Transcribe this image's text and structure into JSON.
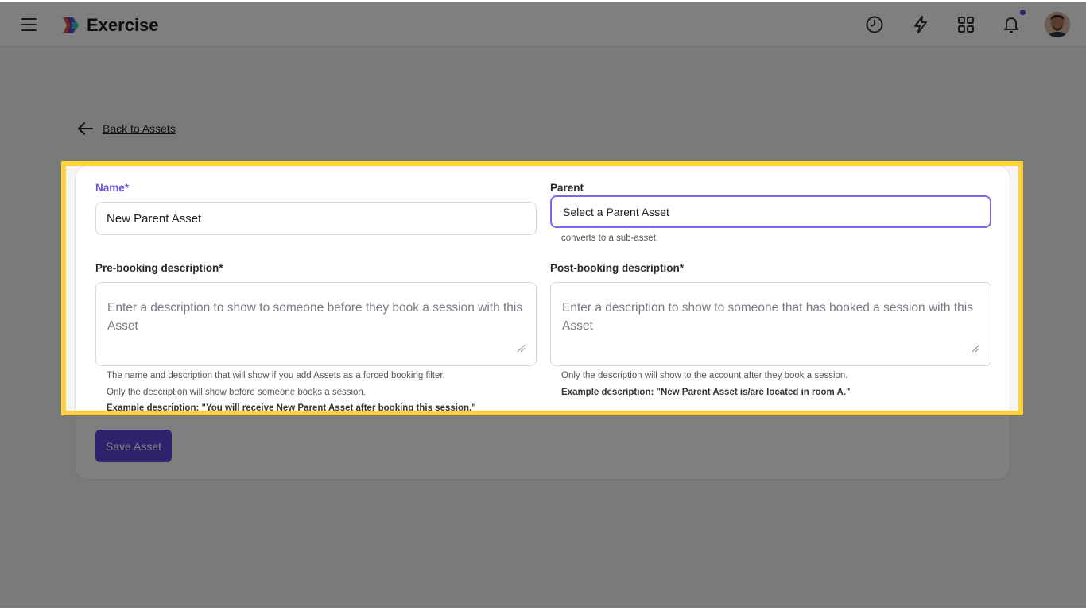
{
  "header": {
    "app_title": "Exercise",
    "icons": [
      "menu-icon",
      "clock-icon",
      "lightning-icon",
      "apps-grid-icon",
      "bell-icon"
    ],
    "accent_color": "#5b45d6"
  },
  "nav": {
    "back_label": "Back to Assets"
  },
  "form": {
    "name": {
      "label": "Name*",
      "value": "New Parent Asset"
    },
    "parent": {
      "label": "Parent",
      "placeholder": "Select a Parent Asset",
      "help": "converts to a sub-asset"
    },
    "pre_booking": {
      "label": "Pre-booking description*",
      "placeholder": "Enter a description to show to someone before they book a session with this Asset",
      "help_1": "The name and description that will show if you add Assets as a forced booking filter.",
      "help_2": "Only the description will show before someone books a session.",
      "example": "Example description: \"You will receive New Parent Asset after booking this session.\""
    },
    "post_booking": {
      "label": "Post-booking description*",
      "placeholder": "Enter a description to show to someone that has booked a session with this Asset",
      "help_1": "Only the description will show to the account after they book a session.",
      "example": "Example description: \"New Parent Asset is/are located in room A.\""
    },
    "save_label": "Save Asset"
  },
  "highlight_color": "#fbd33a"
}
